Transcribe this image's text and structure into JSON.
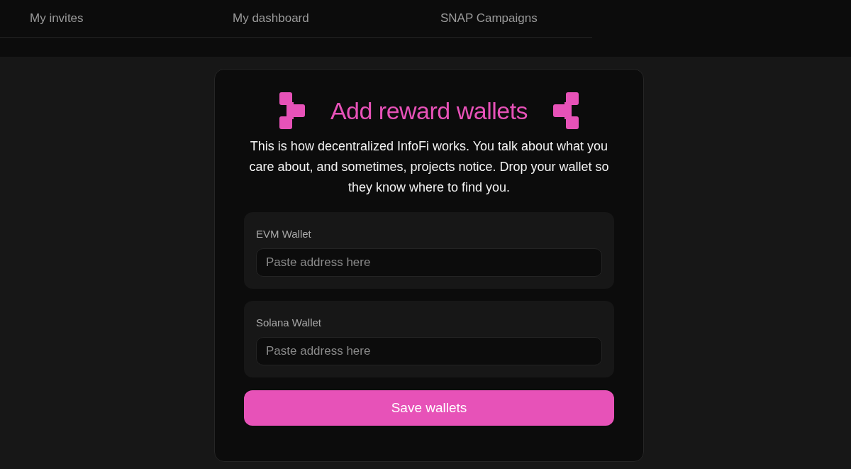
{
  "nav": {
    "tabs": [
      {
        "label": "My invites"
      },
      {
        "label": "My dashboard"
      },
      {
        "label": "SNAP Campaigns"
      }
    ]
  },
  "card": {
    "title": "Add reward wallets",
    "description": "This is how decentralized InfoFi works. You talk about what you care about, and sometimes, projects notice. Drop your wallet so they know where to find you.",
    "fields": [
      {
        "label": "EVM Wallet",
        "placeholder": "Paste address here"
      },
      {
        "label": "Solana Wallet",
        "placeholder": "Paste address here"
      }
    ],
    "button": "Save wallets"
  }
}
